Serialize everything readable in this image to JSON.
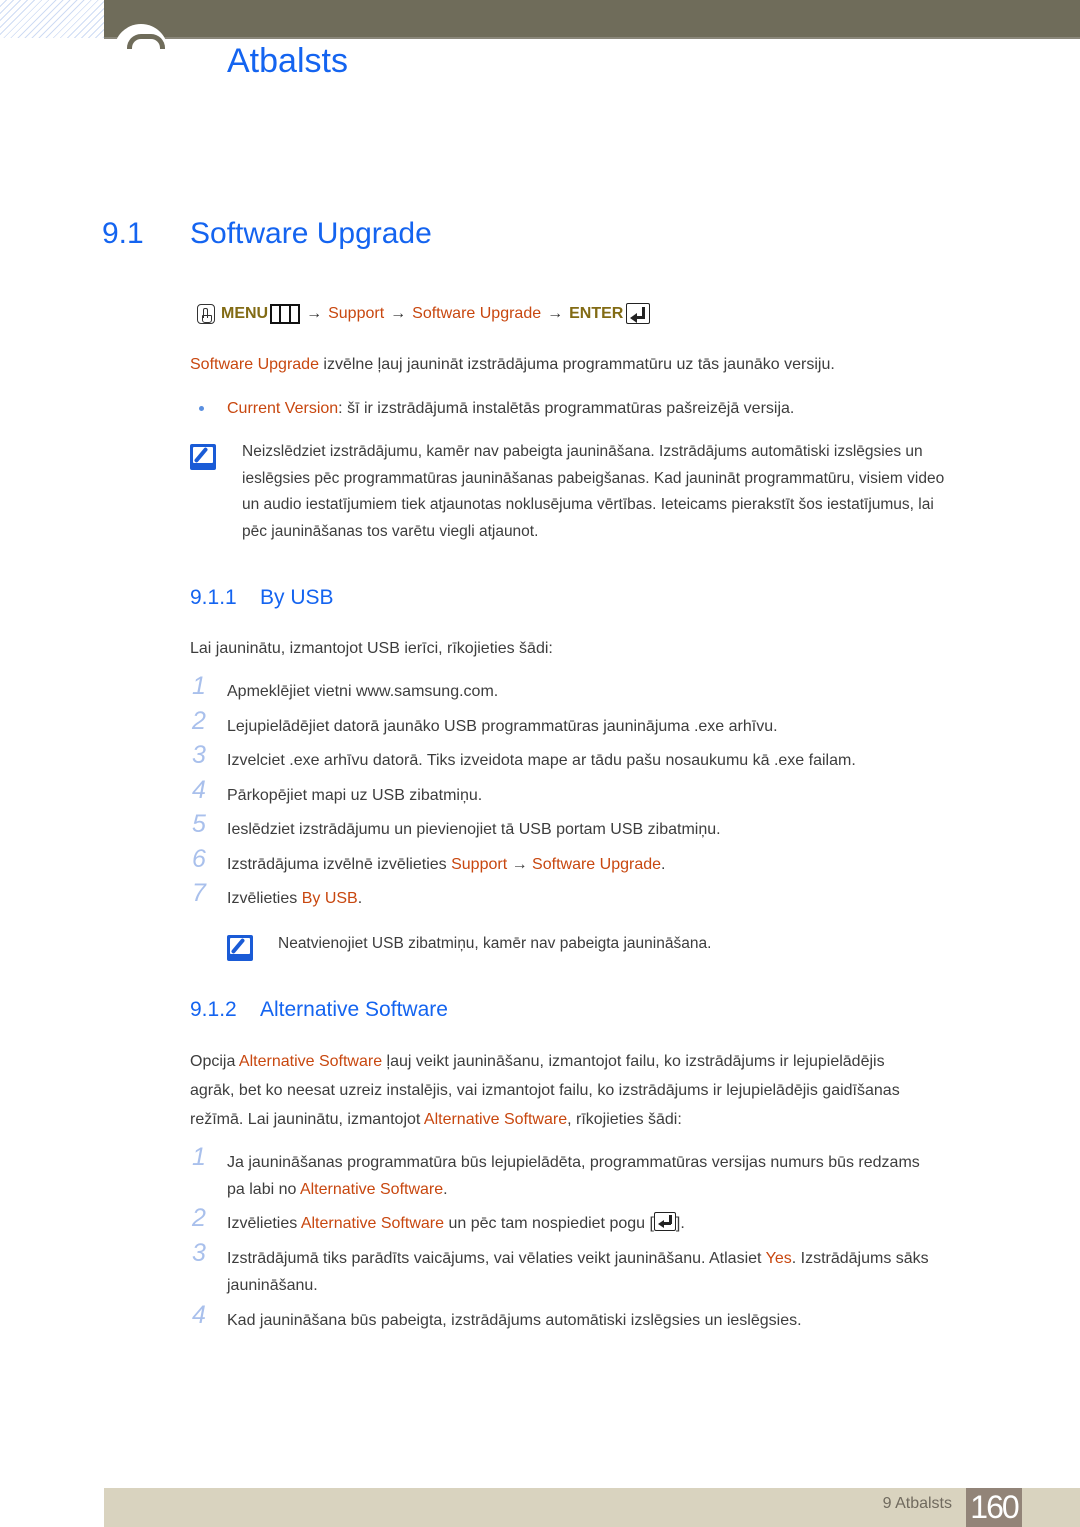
{
  "header": {
    "chapter_title": "Atbalsts"
  },
  "section": {
    "number": "9.1",
    "title": "Software Upgrade"
  },
  "menu_path": {
    "menu_label": "MENU",
    "arrow": "→",
    "support": "Support",
    "software_upgrade": "Software Upgrade",
    "enter_label": "ENTER"
  },
  "intro": {
    "term": "Software Upgrade",
    "text": " izvēlne ļauj jaunināt izstrādājuma programmatūru uz tās jaunāko versiju."
  },
  "bullet": {
    "term": "Current Version",
    "text": ": šī ir izstrādājumā instalētās programmatūras pašreizējā versija."
  },
  "note1": {
    "lines": [
      "Neizslēdziet izstrādājumu, kamēr nav pabeigta jaunināšana. Izstrādājums automātiski izslēgsies un",
      "ieslēgsies pēc programmatūras jaunināšanas pabeigšanas. Kad jaunināt programmatūru, visiem video",
      "un audio iestatījumiem tiek atjaunotas noklusējuma vērtības. Ieteicams pierakstīt šos iestatījumus, lai",
      "pēc jaunināšanas tos varētu viegli atjaunot."
    ]
  },
  "by_usb": {
    "number": "9.1.1",
    "title": "By USB",
    "intro": "Lai jauninātu, izmantojot USB ierīci, rīkojieties šādi:",
    "steps": [
      {
        "n": "1",
        "text": "Apmeklējiet vietni www.samsung.com."
      },
      {
        "n": "2",
        "text": "Lejupielādējiet datorā jaunāko USB programmatūras jauninājuma .exe arhīvu."
      },
      {
        "n": "3",
        "text": "Izvelciet .exe arhīvu datorā. Tiks izveidota mape ar tādu pašu nosaukumu kā .exe failam."
      },
      {
        "n": "4",
        "text": "Pārkopējiet mapi uz USB zibatmiņu."
      },
      {
        "n": "5",
        "text": "Ieslēdziet izstrādājumu un pievienojiet tā USB portam USB zibatmiņu."
      },
      {
        "n": "6",
        "prefix": "Izstrādājuma izvēlnē izvēlieties ",
        "term1": "Support",
        "arrow": "→",
        "term2": "Software Upgrade",
        "suffix": "."
      },
      {
        "n": "7",
        "prefix": "Izvēlieties ",
        "term1": "By USB",
        "suffix": "."
      }
    ],
    "note": "Neatvienojiet USB zibatmiņu, kamēr nav pabeigta jaunināšana."
  },
  "alt_software": {
    "number": "9.1.2",
    "title": "Alternative Software",
    "intro": {
      "l1_prefix": "Opcija ",
      "l1_term": "Alternative Software",
      "l1_suffix": " ļauj veikt jaunināšanu, izmantojot failu, ko izstrādājums ir lejupielādējis",
      "l2": "agrāk, bet ko neesat uzreiz instalējis, vai izmantojot failu, ko izstrādājums ir lejupielādējis gaidīšanas",
      "l3_prefix": "režīmā. Lai jauninātu, izmantojot ",
      "l3_term": "Alternative Software",
      "l3_suffix": ", rīkojieties šādi:"
    },
    "steps": [
      {
        "n": "1",
        "line1": "Ja jaunināšanas programmatūra būs lejupielādēta, programmatūras versijas numurs būs redzams",
        "l2_prefix": "pa labi no ",
        "l2_term": "Alternative Software",
        "l2_suffix": "."
      },
      {
        "n": "2",
        "prefix": "Izvēlieties ",
        "term": "Alternative Software",
        "middle": " un pēc tam nospiediet pogu [",
        "suffix": "]."
      },
      {
        "n": "3",
        "prefix": "Izstrādājumā tiks parādīts vaicājums, vai vēlaties veikt jaunināšanu. Atlasiet ",
        "term": "Yes",
        "suffix": ". Izstrādājums sāks",
        "line2": "jaunināšanu."
      },
      {
        "n": "4",
        "text": "Kad jaunināšana būs pabeigta, izstrādājums automātiski izslēgsies un ieslēgsies."
      }
    ]
  },
  "footer": {
    "chapter_label": "9 Atbalsts",
    "page_number": "160"
  }
}
